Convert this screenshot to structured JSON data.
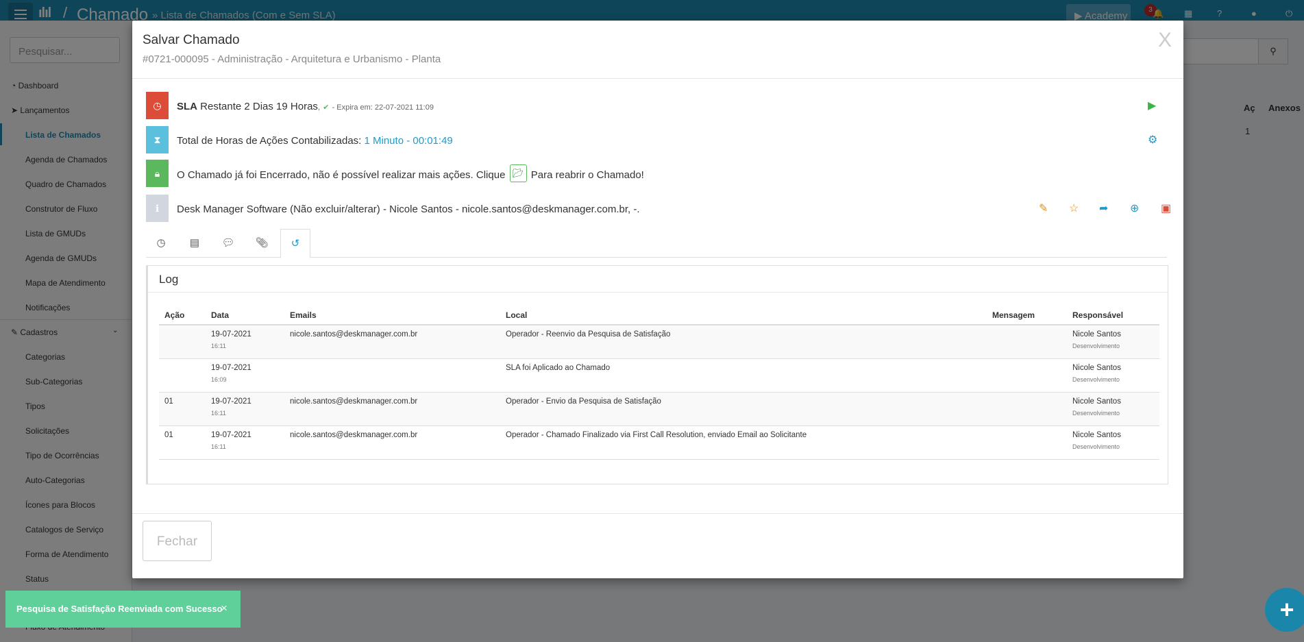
{
  "topbar": {
    "title": "Chamado",
    "subtitle": "» Lista de Chamados (Com e Sem SLA)",
    "academy_label": "Academy",
    "notification_count": "3"
  },
  "sidebar": {
    "search_placeholder": "Pesquisar...",
    "items": [
      {
        "label": "Dashboard"
      },
      {
        "label": "Lançamentos"
      },
      {
        "label": "Lista de Chamados"
      },
      {
        "label": "Agenda de Chamados"
      },
      {
        "label": "Quadro de Chamados"
      },
      {
        "label": "Construtor de Fluxo"
      },
      {
        "label": "Lista de GMUDs"
      },
      {
        "label": "Agenda de GMUDs"
      },
      {
        "label": "Mapa de Atendimento"
      },
      {
        "label": "Notificações"
      },
      {
        "label": "Cadastros"
      },
      {
        "label": "Categorias"
      },
      {
        "label": "Sub-Categorias"
      },
      {
        "label": "Tipos"
      },
      {
        "label": "Solicitações"
      },
      {
        "label": "Tipo de Ocorrências"
      },
      {
        "label": "Auto-Categorias"
      },
      {
        "label": "Ícones para Blocos"
      },
      {
        "label": "Catalogos de Serviço"
      },
      {
        "label": "Forma de Atendimento"
      },
      {
        "label": "Status"
      },
      {
        "label": "Fluxo de Atendimento"
      }
    ]
  },
  "background": {
    "col_ac": "Aç",
    "col_anexos": "Anexos",
    "row_value": "1"
  },
  "modal": {
    "title": "Salvar Chamado",
    "subtitle": "#0721-000095 - Administração - Arquitetura e Urbanismo - Planta",
    "close_label": "X",
    "sla": {
      "label": "SLA",
      "remaining": "Restante 2 Dias 19 Horas",
      "comma": ",",
      "expires": "- Expira em: 22-07-2021 11:09"
    },
    "hours": {
      "label": "Total de Horas de Ações Contabilizadas:",
      "value": "1 Minuto - 00:01:49"
    },
    "closed": {
      "text_before": "O Chamado já foi Encerrado, não é possível realizar mais ações. Clique",
      "text_after": "Para reabrir o Chamado!"
    },
    "requester": "Desk Manager Software (Não excluir/alterar) - Nicole Santos - nicole.santos@deskmanager.com.br, -.",
    "log": {
      "title": "Log",
      "columns": [
        "Ação",
        "Data",
        "Emails",
        "Local",
        "Mensagem",
        "Responsável"
      ],
      "rows": [
        {
          "acao": "",
          "data": "19-07-2021",
          "hora": "16:11",
          "email": "nicole.santos@deskmanager.com.br",
          "local": "Operador - Reenvio da Pesquisa de Satisfação",
          "mensagem": "",
          "responsavel": "Nicole Santos",
          "setor": "Desenvolvimento"
        },
        {
          "acao": "",
          "data": "19-07-2021",
          "hora": "16:09",
          "email": "",
          "local": "SLA foi Aplicado ao Chamado",
          "mensagem": "",
          "responsavel": "Nicole Santos",
          "setor": "Desenvolvimento"
        },
        {
          "acao": "01",
          "data": "19-07-2021",
          "hora": "16:11",
          "email": "nicole.santos@deskmanager.com.br",
          "local": "Operador - Envio da Pesquisa de Satisfação",
          "mensagem": "",
          "responsavel": "Nicole Santos",
          "setor": "Desenvolvimento"
        },
        {
          "acao": "01",
          "data": "19-07-2021",
          "hora": "16:11",
          "email": "nicole.santos@deskmanager.com.br",
          "local": "Operador - Chamado Finalizado via First Call Resolution, enviado Email ao Solicitante",
          "mensagem": "",
          "responsavel": "Nicole Santos",
          "setor": "Desenvolvimento"
        }
      ]
    },
    "close_button": "Fechar"
  },
  "toast": {
    "message": "Pesquisa de Satisfação Reenviada com Sucesso",
    "close": "×"
  },
  "colors": {
    "primary": "#1f8bb0",
    "sla_red": "#dd4b39",
    "hours_blue": "#5bc0de",
    "closed_green": "#5cb85c",
    "info_gray": "#d2d6de",
    "toast_green": "#5fd09a"
  },
  "icons": {
    "menu": "hamburger-icon",
    "sla": "clock-icon",
    "hours": "hourglass-icon",
    "closed": "lock-icon",
    "info": "info-icon",
    "play": "play-icon",
    "settings": "gear-icon",
    "reopen": "folder-open-icon"
  }
}
